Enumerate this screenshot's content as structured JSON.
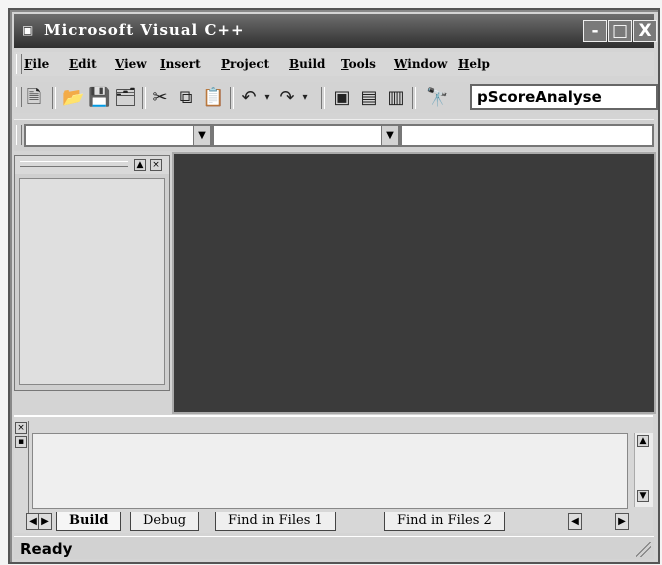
{
  "window": {
    "title": "Microsoft Visual C++",
    "controls": {
      "minimize": "-",
      "maximize": "□",
      "close": "X"
    }
  },
  "menu": {
    "items": [
      "File",
      "Edit",
      "View",
      "Insert",
      "Project",
      "Build",
      "Tools",
      "Window",
      "Help"
    ]
  },
  "toolbar": {
    "project_value": "pScoreAnalyse"
  },
  "output": {
    "tabs": [
      "Build",
      "Debug",
      "Find in Files 1",
      "Find in Files 2"
    ]
  },
  "status": {
    "text": "Ready"
  }
}
